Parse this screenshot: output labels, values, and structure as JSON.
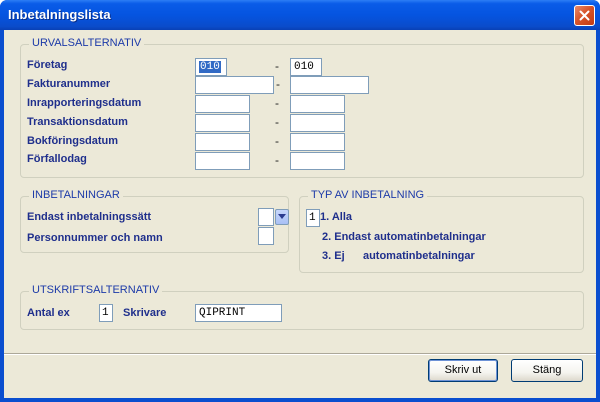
{
  "window": {
    "title": "Inbetalningslista"
  },
  "urval": {
    "title": "URVALSALTERNATIV",
    "dash": "-",
    "rows": [
      {
        "label": "Företag",
        "from": "010",
        "to": "010"
      },
      {
        "label": "Fakturanummer",
        "from": "",
        "to": ""
      },
      {
        "label": "Inrapporteringsdatum",
        "from": "",
        "to": ""
      },
      {
        "label": "Transaktionsdatum",
        "from": "",
        "to": ""
      },
      {
        "label": "Bokföringsdatum",
        "from": "",
        "to": ""
      },
      {
        "label": "Förfallodag",
        "from": "",
        "to": ""
      }
    ]
  },
  "inbetalningar": {
    "title": "INBETALNINGAR",
    "endast_label": "Endast inbetalningssätt",
    "endast_value": "",
    "personnummer_label": "Personnummer och namn",
    "personnummer_value": ""
  },
  "typ": {
    "title": "TYP AV INBETALNING",
    "value": "1",
    "options": [
      "1. Alla",
      "2. Endast automatinbetalningar",
      "3. Ej      automatinbetalningar"
    ]
  },
  "utskrift": {
    "title": "UTSKRIFTSALTERNATIV",
    "antal_label": "Antal ex",
    "antal_value": "1",
    "skrivare_label": "Skrivare",
    "skrivare_value": "QIPRINT"
  },
  "buttons": {
    "print": "Skriv ut",
    "close": "Stäng"
  },
  "icons": {
    "close": "close-icon",
    "dropdown": "chevron-down-icon"
  }
}
